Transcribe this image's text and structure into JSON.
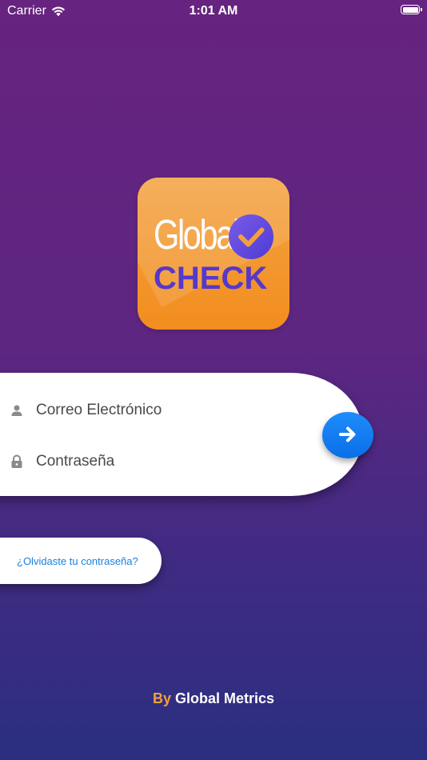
{
  "status_bar": {
    "carrier": "Carrier",
    "time": "1:01 AM",
    "battery_level": 1.0
  },
  "logo": {
    "word1": "Global",
    "word2": "CHECK",
    "colors": {
      "tile": "#f39a30",
      "badge": "#6a4fe0",
      "word2": "#5538cc"
    }
  },
  "login": {
    "email": {
      "placeholder": "Correo Electrónico",
      "icon": "user-icon"
    },
    "password": {
      "placeholder": "Contraseña",
      "icon": "lock-icon"
    },
    "submit_icon": "arrow-right-icon"
  },
  "forgot_password": {
    "label": "¿Olvidaste tu contraseña?"
  },
  "footer": {
    "by": "By",
    "company": "Global Metrics"
  },
  "colors": {
    "background_top": "#66237f",
    "background_bottom": "#2b2f80",
    "accent_blue": "#1a7fe0",
    "accent_orange": "#f5a03a"
  }
}
